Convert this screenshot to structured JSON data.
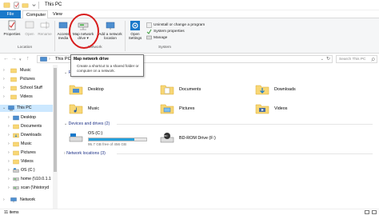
{
  "window": {
    "title": "This PC"
  },
  "tabs": [
    {
      "label": "File"
    },
    {
      "label": "Computer"
    },
    {
      "label": "View"
    }
  ],
  "ribbon": {
    "location": {
      "properties": "Properties",
      "open": "Open",
      "rename": "Rename",
      "group_label": "Location"
    },
    "network": {
      "access_media": [
        "Access",
        "media"
      ],
      "map_network_drive": [
        "Map network",
        "drive ▾"
      ],
      "add_network_location": [
        "Add a network",
        "location"
      ],
      "group_label": "Network"
    },
    "system": {
      "open_settings": [
        "Open",
        "Settings"
      ],
      "uninstall": "Uninstall or change a program",
      "system_properties": "System properties",
      "manage": "Manage",
      "group_label": "System"
    }
  },
  "address_bar": {
    "path": "This PC",
    "search_placeholder": "Search This PC"
  },
  "tooltip": {
    "title": "Map network drive",
    "body": "Create a shortcut to a shared folder or computer on a network."
  },
  "sidebar": {
    "items": [
      {
        "label": "Music"
      },
      {
        "label": "Pictures"
      },
      {
        "label": "School Stuff"
      },
      {
        "label": "Videos"
      },
      {
        "label": "This PC"
      },
      {
        "label": "Desktop"
      },
      {
        "label": "Documents"
      },
      {
        "label": "Downloads"
      },
      {
        "label": "Music"
      },
      {
        "label": "Pictures"
      },
      {
        "label": "Videos"
      },
      {
        "label": "OS (C:)"
      },
      {
        "label": "home (\\\\10.0.1.1"
      },
      {
        "label": "scan (\\\\historyd"
      },
      {
        "label": "Network"
      }
    ]
  },
  "content": {
    "folders_header": "Fo",
    "folders": [
      {
        "label": "Desktop"
      },
      {
        "label": "Documents"
      },
      {
        "label": "Downloads"
      },
      {
        "label": "Music"
      },
      {
        "label": "Pictures"
      },
      {
        "label": "Videos"
      }
    ],
    "devices_header": "Devices and drives (2)",
    "drives": [
      {
        "label": "OS (C:)",
        "free": "95.7 GB free of 456 GB",
        "used_fraction": 0.79
      },
      {
        "label": "BD-ROM Drive (F:)"
      }
    ],
    "network_header": "Network locations (3)"
  },
  "status": {
    "items": "11 items"
  },
  "colors": {
    "accent": "#1979ca",
    "selection": "#cce8ff",
    "highlight_circle": "#d81d1d",
    "folder": "#f8d775",
    "drive_fill": "#26a0da",
    "header_text": "#1e3287"
  }
}
